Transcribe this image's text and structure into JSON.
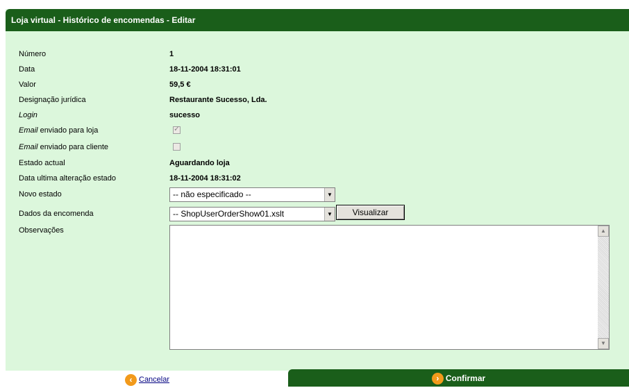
{
  "title": "Loja virtual - Histórico de encomendas - Editar",
  "fields": [
    {
      "label": "Número",
      "value": "1"
    },
    {
      "label": "Data",
      "value": "18-11-2004 18:31:01"
    },
    {
      "label": "Valor",
      "value": "59,5 €"
    },
    {
      "label": "Designação jurídica",
      "value": "Restaurante Sucesso, Lda."
    },
    {
      "label": "Login",
      "value": "sucesso"
    }
  ],
  "email_loja": {
    "label_em": "Email",
    "label_rest": " enviado para loja",
    "checked": true
  },
  "email_cliente": {
    "label_em": "Email",
    "label_rest": " enviado para cliente",
    "checked": false
  },
  "estado_actual": {
    "label": "Estado actual",
    "value": "Aguardando loja"
  },
  "data_alteracao": {
    "label": "Data ultima alteração estado",
    "value": "18-11-2004 18:31:02"
  },
  "novo_estado": {
    "label": "Novo estado",
    "selected": "-- não especificado --"
  },
  "dados_encomenda": {
    "label": "Dados da encomenda",
    "selected": "-- ShopUserOrderShow01.xslt",
    "button": "Visualizar"
  },
  "observacoes": {
    "label": "Observações",
    "value": ""
  },
  "footer": {
    "cancel": "Cancelar",
    "confirm": "Confirmar"
  },
  "colors": {
    "accent": "#1a5e1a",
    "panel": "#dcf7dc",
    "icon": "#f29a1b"
  }
}
